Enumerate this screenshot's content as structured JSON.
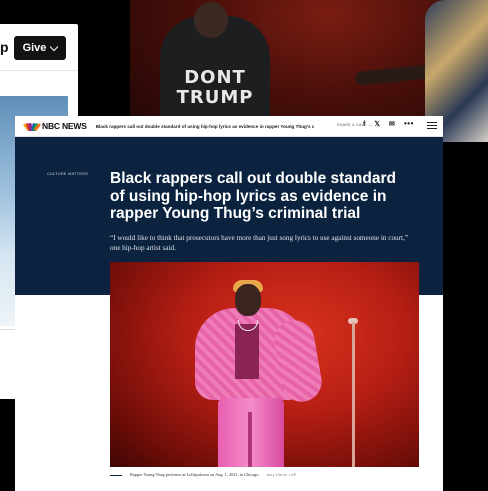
{
  "back_page": {
    "nav_partial_label": "p",
    "give_button_label": "Give"
  },
  "back_photo": {
    "shirt_line1": "DONT",
    "shirt_line2": "TRUMP"
  },
  "nbc": {
    "logo_text": "NBC NEWS",
    "top_bar_headline": "Black rappers call out double standard of using hip-hop lyrics as evidence in rapper Young Thug's crim",
    "share_label": "SHARE & SAVE —",
    "facebook_icon": "f",
    "x_icon": "𝕏",
    "mail_icon": "✉",
    "more_icon": "•••",
    "section_label": "CULTURE MATTERS",
    "headline": "Black rappers call out double standard of using hip-hop lyrics as evidence in rapper Young Thug’s criminal trial",
    "dek": "“I would like to think that prosecutors have more than just song lyrics to use against someone in court,” one hip-hop artist said.",
    "caption": "Rapper Young Thug performs at Lollapalooza on Aug. 1, 2021, in Chicago.",
    "credit": "Amy Harris / AP",
    "colors": {
      "hero_navy": "#0c2340",
      "peacock": [
        "#f4ab1b",
        "#e1292e",
        "#8f2c8c",
        "#1b5faa",
        "#08a14c",
        "#f37021"
      ]
    }
  }
}
